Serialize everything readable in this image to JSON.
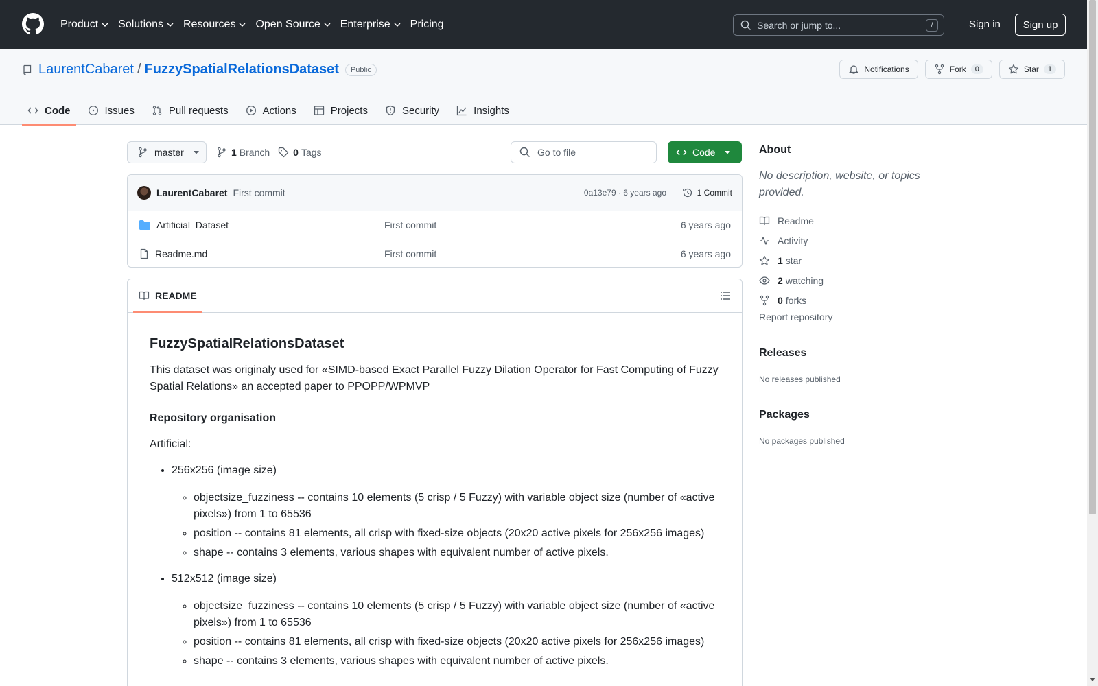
{
  "header": {
    "nav": [
      "Product",
      "Solutions",
      "Resources",
      "Open Source",
      "Enterprise",
      "Pricing"
    ],
    "search_placeholder": "Search or jump to...",
    "search_kbd": "/",
    "sign_in": "Sign in",
    "sign_up": "Sign up"
  },
  "repo": {
    "owner": "LaurentCabaret",
    "name": "FuzzySpatialRelationsDataset",
    "visibility": "Public",
    "notifications": "Notifications",
    "fork_label": "Fork",
    "fork_count": "0",
    "star_label": "Star",
    "star_count": "1"
  },
  "tabs": [
    "Code",
    "Issues",
    "Pull requests",
    "Actions",
    "Projects",
    "Security",
    "Insights"
  ],
  "branch": {
    "name": "master",
    "branch_count": "1",
    "branch_label": "Branch",
    "tag_count": "0",
    "tag_label": "Tags",
    "go_to_file": "Go to file",
    "code_button": "Code"
  },
  "commit": {
    "author": "LaurentCabaret",
    "message": "First commit",
    "hash_age": "0a13e79 · 6 years ago",
    "commits": "1 Commit"
  },
  "files": [
    {
      "name": "Artificial_Dataset",
      "type": "folder",
      "message": "First commit",
      "age": "6 years ago"
    },
    {
      "name": "Readme.md",
      "type": "file",
      "message": "First commit",
      "age": "6 years ago"
    }
  ],
  "readme": {
    "tab": "README",
    "title": "FuzzySpatialRelationsDataset",
    "intro": "This dataset was originaly used for «SIMD-based Exact Parallel Fuzzy Dilation Operator for Fast Computing of Fuzzy Spatial Relations» an accepted paper to PPOPP/WPMVP",
    "section": "Repository organisation",
    "artificial": "Artificial:",
    "groups": [
      {
        "label": "256x256 (image size)",
        "items": [
          "objectsize_fuzziness -- contains 10 elements (5 crisp / 5 Fuzzy) with variable object size (number of «active pixels») from 1 to 65536",
          "position -- contains 81 elements, all crisp with fixed-size objects (20x20 active pixels for 256x256 images)",
          "shape -- contains 3 elements, various shapes with equivalent number of active pixels."
        ]
      },
      {
        "label": "512x512 (image size)",
        "items": [
          "objectsize_fuzziness -- contains 10 elements (5 crisp / 5 Fuzzy) with variable object size (number of «active pixels») from 1 to 65536",
          "position -- contains 81 elements, all crisp with fixed-size objects (20x20 active pixels for 256x256 images)",
          "shape -- contains 3 elements, various shapes with equivalent number of active pixels."
        ]
      }
    ]
  },
  "about": {
    "title": "About",
    "description": "No description, website, or topics provided.",
    "readme": "Readme",
    "activity": "Activity",
    "stars_count": "1",
    "stars_label": "star",
    "watching_count": "2",
    "watching_label": "watching",
    "forks_count": "0",
    "forks_label": "forks",
    "report": "Report repository"
  },
  "releases": {
    "title": "Releases",
    "none": "No releases published"
  },
  "packages": {
    "title": "Packages",
    "none": "No packages published"
  },
  "colors": {
    "header_bg": "#24292f",
    "link": "#0969da",
    "primary": "#1f883d",
    "tab_underline": "#fd8c73"
  }
}
